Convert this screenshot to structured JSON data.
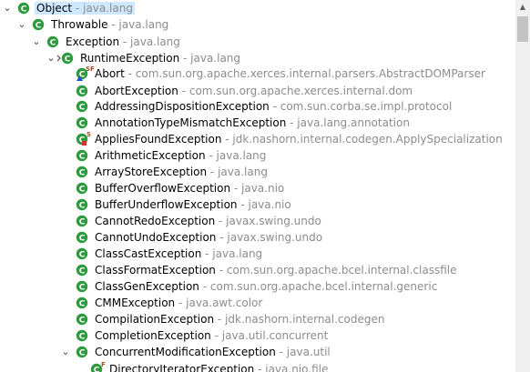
{
  "tree": {
    "rows": [
      {
        "cls": "Object",
        "pkg": "java.lang",
        "tw": "open",
        "mod": "",
        "selected": true
      },
      {
        "cls": "Throwable",
        "pkg": "java.lang",
        "tw": "open",
        "mod": ""
      },
      {
        "cls": "Exception",
        "pkg": "java.lang",
        "tw": "open",
        "mod": ""
      },
      {
        "cls": "RuntimeException",
        "pkg": "java.lang",
        "tw": "open",
        "mod": "sub"
      },
      {
        "cls": "Abort",
        "pkg": "com.sun.org.apache.xerces.internal.parsers.AbstractDOMParser",
        "tw": "",
        "mod": "SF-nested"
      },
      {
        "cls": "AbortException",
        "pkg": "com.sun.org.apache.xerces.internal.dom",
        "tw": "",
        "mod": ""
      },
      {
        "cls": "AddressingDispositionException",
        "pkg": "com.sun.corba.se.impl.protocol",
        "tw": "",
        "mod": ""
      },
      {
        "cls": "AnnotationTypeMismatchException",
        "pkg": "java.lang.annotation",
        "tw": "",
        "mod": ""
      },
      {
        "cls": "AppliesFoundException",
        "pkg": "jdk.nashorn.internal.codegen.ApplySpecialization",
        "tw": "",
        "mod": "S-private"
      },
      {
        "cls": "ArithmeticException",
        "pkg": "java.lang",
        "tw": "",
        "mod": ""
      },
      {
        "cls": "ArrayStoreException",
        "pkg": "java.lang",
        "tw": "",
        "mod": ""
      },
      {
        "cls": "BufferOverflowException",
        "pkg": "java.nio",
        "tw": "",
        "mod": ""
      },
      {
        "cls": "BufferUnderflowException",
        "pkg": "java.nio",
        "tw": "",
        "mod": ""
      },
      {
        "cls": "CannotRedoException",
        "pkg": "javax.swing.undo",
        "tw": "",
        "mod": ""
      },
      {
        "cls": "CannotUndoException",
        "pkg": "javax.swing.undo",
        "tw": "",
        "mod": ""
      },
      {
        "cls": "ClassCastException",
        "pkg": "java.lang",
        "tw": "",
        "mod": ""
      },
      {
        "cls": "ClassFormatException",
        "pkg": "com.sun.org.apache.bcel.internal.classfile",
        "tw": "",
        "mod": ""
      },
      {
        "cls": "ClassGenException",
        "pkg": "com.sun.org.apache.bcel.internal.generic",
        "tw": "",
        "mod": ""
      },
      {
        "cls": "CMMException",
        "pkg": "java.awt.color",
        "tw": "",
        "mod": ""
      },
      {
        "cls": "CompilationException",
        "pkg": "jdk.nashorn.internal.codegen",
        "tw": "",
        "mod": ""
      },
      {
        "cls": "CompletionException",
        "pkg": "java.util.concurrent",
        "tw": "",
        "mod": ""
      },
      {
        "cls": "ConcurrentModificationException",
        "pkg": "java.util",
        "tw": "open",
        "mod": ""
      },
      {
        "cls": "DirectoryIteratorException",
        "pkg": "java.nio.file",
        "tw": "",
        "mod": "F"
      }
    ]
  },
  "separator": " - ",
  "icons": {
    "class": "class-icon",
    "expanded": "chevron-down-icon",
    "scroll_up": "up-arrow-icon"
  },
  "colors": {
    "class_icon": "#2e9a3e",
    "selection": "#cde8ff",
    "package_text": "#8c8c8c",
    "modifier_text": "#a0522d",
    "nested_marker": "#1f55c8",
    "private_marker": "#d03030"
  }
}
